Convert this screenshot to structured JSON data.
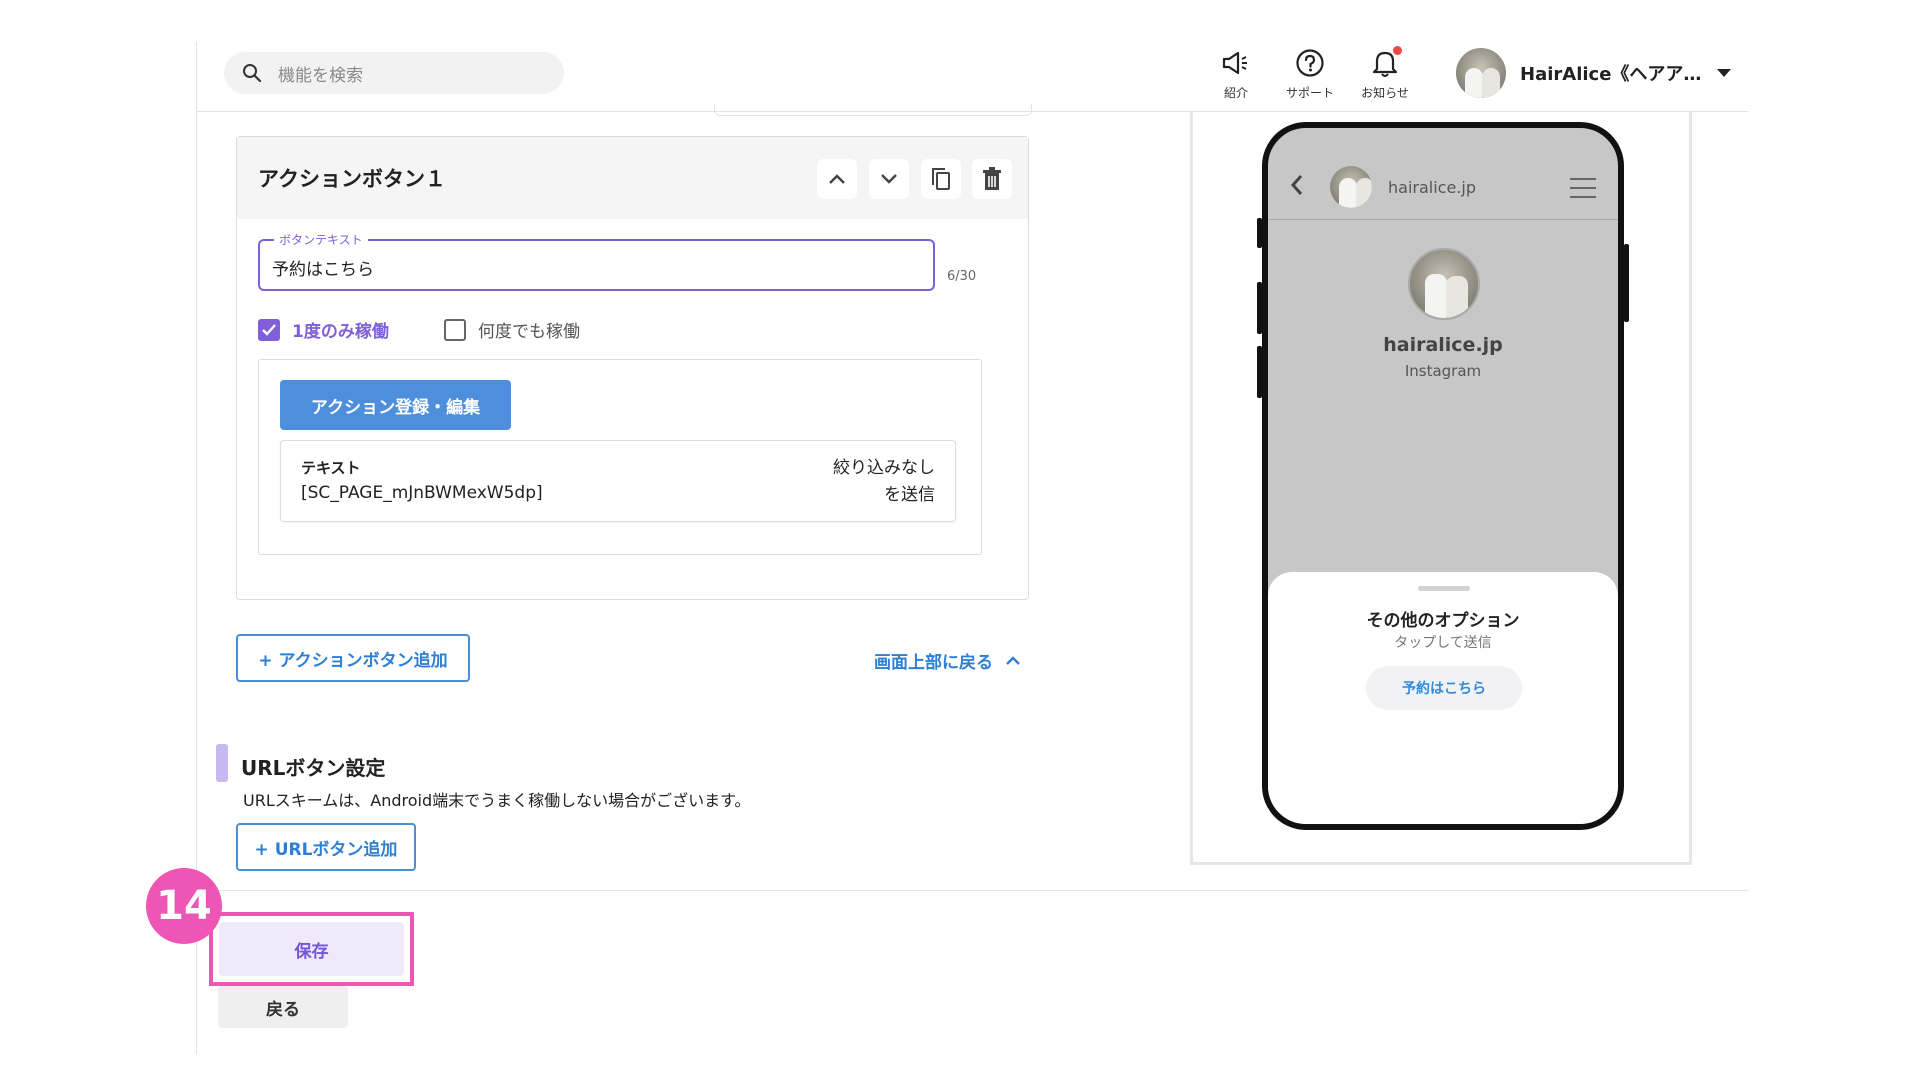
{
  "header": {
    "search_placeholder": "機能を検索",
    "intro_label": "紹介",
    "support_label": "サポート",
    "notifications_label": "お知らせ",
    "user_name": "HairAlice《ヘアア…"
  },
  "action_card": {
    "title": "アクションボタン１",
    "field_label": "ボタンテキスト",
    "field_value": "予約はこちら",
    "counter": "6/30",
    "option_once": "1度のみ稼働",
    "option_once_checked": true,
    "option_repeat": "何度でも稼働",
    "option_repeat_checked": false,
    "register_button": "アクション登録・編集",
    "action_type": "テキスト",
    "action_payload": "[SC_PAGE_mJnBWMexW5dp]",
    "action_filter_line1": "絞り込みなし",
    "action_filter_line2": "を送信"
  },
  "add_action_button": "+ アクションボタン追加",
  "back_to_top": "画面上部に戻る",
  "url_section": {
    "title": "URLボタン設定",
    "description": "URLスキームは、Android端末でうまく稼働しない場合がございます。",
    "add_button": "+ URLボタン追加"
  },
  "footer": {
    "save": "保存",
    "back": "戻る",
    "step_badge": "14"
  },
  "preview": {
    "username": "hairalice.jp",
    "profile_name": "hairalice.jp",
    "profile_sub": "Instagram",
    "sheet_title": "その他のオプション",
    "sheet_sub": "タップして送信",
    "chip": "予約はこちら"
  },
  "colors": {
    "accent_purple": "#8060d8",
    "action_blue": "#4d8fdc",
    "link_blue": "#2f7fd2",
    "highlight_pink": "#ee55b4",
    "notification_red": "#f04848"
  }
}
